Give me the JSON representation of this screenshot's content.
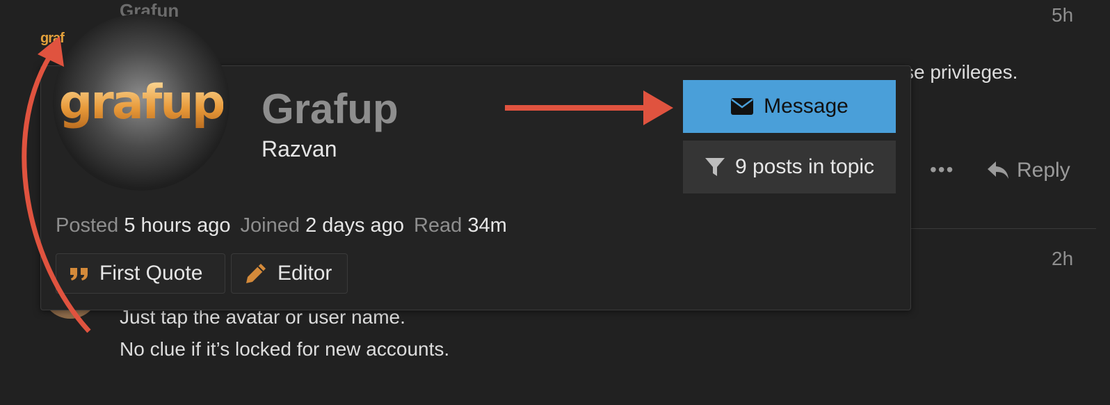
{
  "background": {
    "post1": {
      "author_partial": "Grafun",
      "time": "5h",
      "text_partial": "se privileges.",
      "more_label": "•••",
      "reply_label": "Reply",
      "logo_partial": "graf"
    },
    "post2": {
      "time": "2h",
      "lines": [
        "Just tap the avatar or user name.",
        "No clue if it’s locked for new accounts."
      ]
    }
  },
  "card": {
    "logo_text": "grafup",
    "name": "Grafup",
    "username": "Razvan",
    "message_button": "Message",
    "posts_button": "9 posts in topic",
    "stats": [
      {
        "label": "Posted",
        "value": "5 hours ago"
      },
      {
        "label": "Joined",
        "value": "2 days ago"
      },
      {
        "label": "Read",
        "value": "34m"
      }
    ],
    "quote_button": "First Quote",
    "editor_button": "Editor"
  },
  "colors": {
    "background": "#212121",
    "accent_blue": "#4a9fd9",
    "annotation_arrow": "#e0533f",
    "icon_orange": "#d48a3a"
  }
}
